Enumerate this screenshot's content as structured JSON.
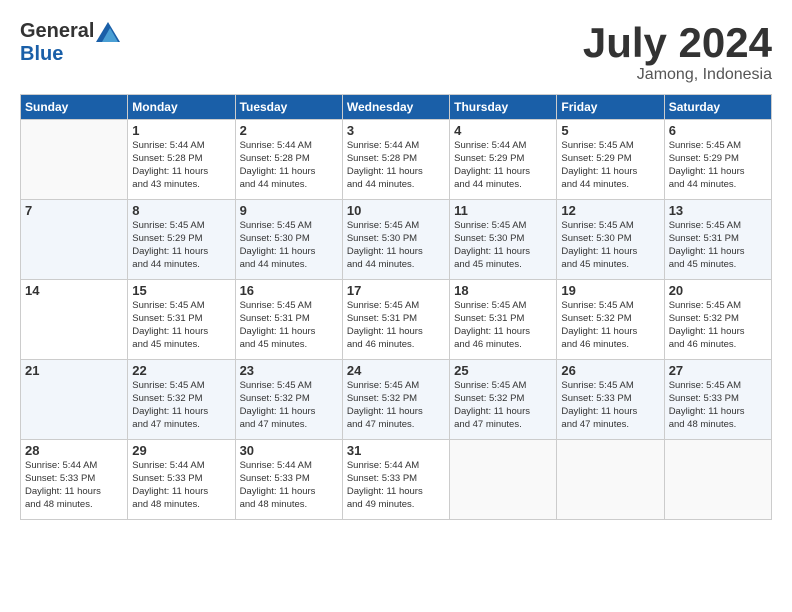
{
  "logo": {
    "general": "General",
    "blue": "Blue"
  },
  "title": "July 2024",
  "location": "Jamong, Indonesia",
  "days_of_week": [
    "Sunday",
    "Monday",
    "Tuesday",
    "Wednesday",
    "Thursday",
    "Friday",
    "Saturday"
  ],
  "weeks": [
    [
      {
        "day": "",
        "info": ""
      },
      {
        "day": "1",
        "info": "Sunrise: 5:44 AM\nSunset: 5:28 PM\nDaylight: 11 hours\nand 43 minutes."
      },
      {
        "day": "2",
        "info": "Sunrise: 5:44 AM\nSunset: 5:28 PM\nDaylight: 11 hours\nand 44 minutes."
      },
      {
        "day": "3",
        "info": "Sunrise: 5:44 AM\nSunset: 5:28 PM\nDaylight: 11 hours\nand 44 minutes."
      },
      {
        "day": "4",
        "info": "Sunrise: 5:44 AM\nSunset: 5:29 PM\nDaylight: 11 hours\nand 44 minutes."
      },
      {
        "day": "5",
        "info": "Sunrise: 5:45 AM\nSunset: 5:29 PM\nDaylight: 11 hours\nand 44 minutes."
      },
      {
        "day": "6",
        "info": "Sunrise: 5:45 AM\nSunset: 5:29 PM\nDaylight: 11 hours\nand 44 minutes."
      }
    ],
    [
      {
        "day": "7",
        "info": ""
      },
      {
        "day": "8",
        "info": "Sunrise: 5:45 AM\nSunset: 5:29 PM\nDaylight: 11 hours\nand 44 minutes."
      },
      {
        "day": "9",
        "info": "Sunrise: 5:45 AM\nSunset: 5:30 PM\nDaylight: 11 hours\nand 44 minutes."
      },
      {
        "day": "10",
        "info": "Sunrise: 5:45 AM\nSunset: 5:30 PM\nDaylight: 11 hours\nand 44 minutes."
      },
      {
        "day": "11",
        "info": "Sunrise: 5:45 AM\nSunset: 5:30 PM\nDaylight: 11 hours\nand 45 minutes."
      },
      {
        "day": "12",
        "info": "Sunrise: 5:45 AM\nSunset: 5:30 PM\nDaylight: 11 hours\nand 45 minutes."
      },
      {
        "day": "13",
        "info": "Sunrise: 5:45 AM\nSunset: 5:31 PM\nDaylight: 11 hours\nand 45 minutes."
      }
    ],
    [
      {
        "day": "14",
        "info": ""
      },
      {
        "day": "15",
        "info": "Sunrise: 5:45 AM\nSunset: 5:31 PM\nDaylight: 11 hours\nand 45 minutes."
      },
      {
        "day": "16",
        "info": "Sunrise: 5:45 AM\nSunset: 5:31 PM\nDaylight: 11 hours\nand 45 minutes."
      },
      {
        "day": "17",
        "info": "Sunrise: 5:45 AM\nSunset: 5:31 PM\nDaylight: 11 hours\nand 46 minutes."
      },
      {
        "day": "18",
        "info": "Sunrise: 5:45 AM\nSunset: 5:31 PM\nDaylight: 11 hours\nand 46 minutes."
      },
      {
        "day": "19",
        "info": "Sunrise: 5:45 AM\nSunset: 5:32 PM\nDaylight: 11 hours\nand 46 minutes."
      },
      {
        "day": "20",
        "info": "Sunrise: 5:45 AM\nSunset: 5:32 PM\nDaylight: 11 hours\nand 46 minutes."
      }
    ],
    [
      {
        "day": "21",
        "info": ""
      },
      {
        "day": "22",
        "info": "Sunrise: 5:45 AM\nSunset: 5:32 PM\nDaylight: 11 hours\nand 47 minutes."
      },
      {
        "day": "23",
        "info": "Sunrise: 5:45 AM\nSunset: 5:32 PM\nDaylight: 11 hours\nand 47 minutes."
      },
      {
        "day": "24",
        "info": "Sunrise: 5:45 AM\nSunset: 5:32 PM\nDaylight: 11 hours\nand 47 minutes."
      },
      {
        "day": "25",
        "info": "Sunrise: 5:45 AM\nSunset: 5:32 PM\nDaylight: 11 hours\nand 47 minutes."
      },
      {
        "day": "26",
        "info": "Sunrise: 5:45 AM\nSunset: 5:33 PM\nDaylight: 11 hours\nand 47 minutes."
      },
      {
        "day": "27",
        "info": "Sunrise: 5:45 AM\nSunset: 5:33 PM\nDaylight: 11 hours\nand 48 minutes."
      }
    ],
    [
      {
        "day": "28",
        "info": "Sunrise: 5:44 AM\nSunset: 5:33 PM\nDaylight: 11 hours\nand 48 minutes."
      },
      {
        "day": "29",
        "info": "Sunrise: 5:44 AM\nSunset: 5:33 PM\nDaylight: 11 hours\nand 48 minutes."
      },
      {
        "day": "30",
        "info": "Sunrise: 5:44 AM\nSunset: 5:33 PM\nDaylight: 11 hours\nand 48 minutes."
      },
      {
        "day": "31",
        "info": "Sunrise: 5:44 AM\nSunset: 5:33 PM\nDaylight: 11 hours\nand 49 minutes."
      },
      {
        "day": "",
        "info": ""
      },
      {
        "day": "",
        "info": ""
      },
      {
        "day": "",
        "info": ""
      }
    ]
  ]
}
